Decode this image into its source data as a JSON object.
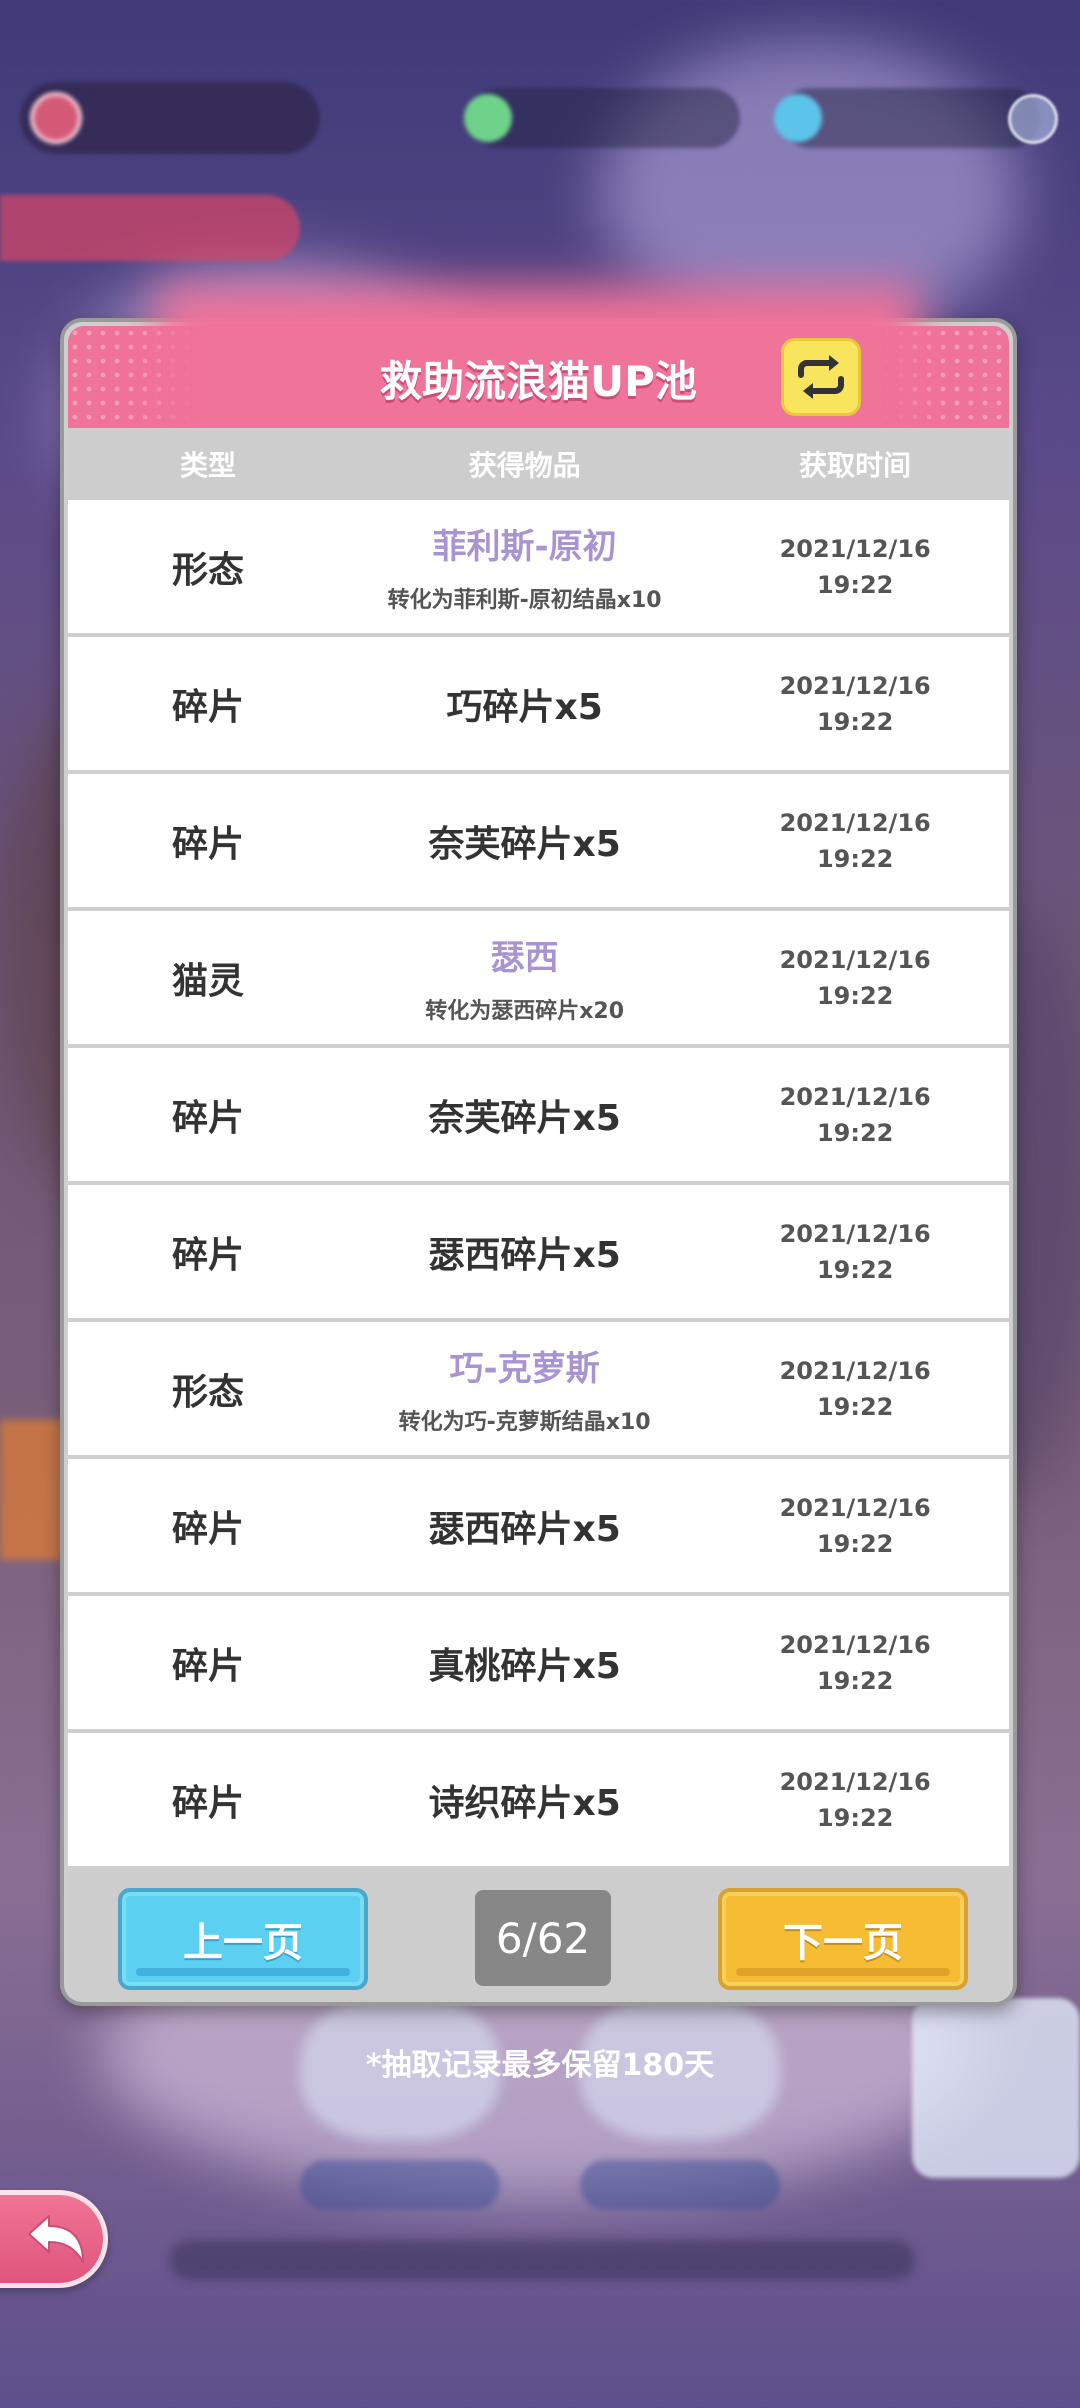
{
  "dialog": {
    "title": "救助流浪猫UP池",
    "switch_icon": "swap-arrows-icon"
  },
  "columns": {
    "type": "类型",
    "item": "获得物品",
    "time": "获取时间"
  },
  "rows": [
    {
      "type": "形态",
      "item": "菲利斯-原初",
      "note": "转化为菲利斯-原初结晶x10",
      "date": "2021/12/16",
      "clock": "19:22"
    },
    {
      "type": "碎片",
      "item": "巧碎片x5",
      "date": "2021/12/16",
      "clock": "19:22"
    },
    {
      "type": "碎片",
      "item": "奈芙碎片x5",
      "date": "2021/12/16",
      "clock": "19:22"
    },
    {
      "type": "猫灵",
      "item": "瑟西",
      "note": "转化为瑟西碎片x20",
      "date": "2021/12/16",
      "clock": "19:22"
    },
    {
      "type": "碎片",
      "item": "奈芙碎片x5",
      "date": "2021/12/16",
      "clock": "19:22"
    },
    {
      "type": "碎片",
      "item": "瑟西碎片x5",
      "date": "2021/12/16",
      "clock": "19:22"
    },
    {
      "type": "形态",
      "item": "巧-克萝斯",
      "note": "转化为巧-克萝斯结晶x10",
      "date": "2021/12/16",
      "clock": "19:22"
    },
    {
      "type": "碎片",
      "item": "瑟西碎片x5",
      "date": "2021/12/16",
      "clock": "19:22"
    },
    {
      "type": "碎片",
      "item": "真桃碎片x5",
      "date": "2021/12/16",
      "clock": "19:22"
    },
    {
      "type": "碎片",
      "item": "诗织碎片x5",
      "date": "2021/12/16",
      "clock": "19:22"
    }
  ],
  "pager": {
    "prev_label": "上一页",
    "next_label": "下一页",
    "page": "6/62"
  },
  "footnote": "*抽取记录最多保留180天",
  "colors": {
    "header_pink": "#f0739a",
    "highlight_purple": "#a894d0",
    "prev_blue": "#5cd0f1",
    "next_orange": "#f6bd34"
  },
  "back_icon": "back-arrow-icon"
}
